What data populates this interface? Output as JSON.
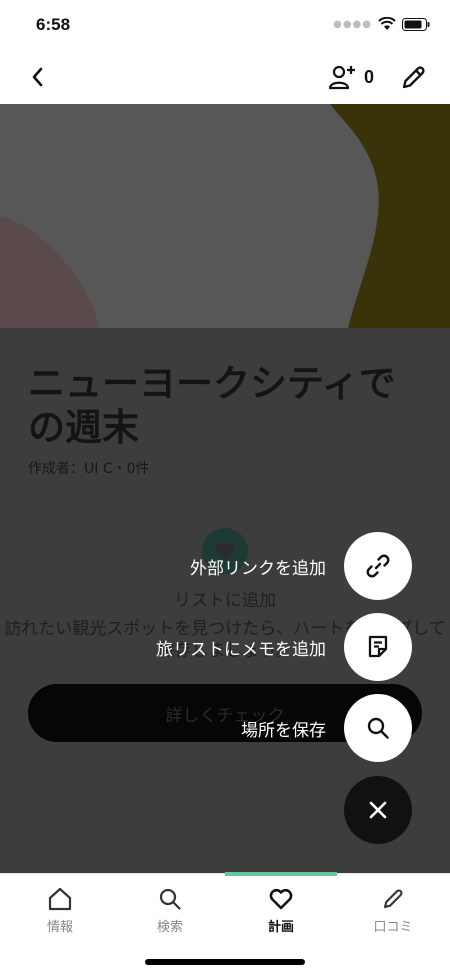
{
  "status": {
    "time": "6:58"
  },
  "nav": {
    "collaborator_count": "0"
  },
  "trip": {
    "title": "ニューヨークシティでの週末",
    "author_line": "作成者：UI C・0件"
  },
  "empty_state": {
    "title": "リストに追加",
    "description": "訪れたい観光スポットを見つけたら、ハートをタップして保存しましょう。",
    "button_label": "詳しくチェック"
  },
  "fab_menu": {
    "items": [
      {
        "label": "外部リンクを追加",
        "icon": "link-icon"
      },
      {
        "label": "旅リストにメモを追加",
        "icon": "note-icon"
      },
      {
        "label": "場所を保存",
        "icon": "search-icon"
      }
    ],
    "close_icon": "close-icon"
  },
  "tabs": [
    {
      "label": "情報",
      "icon": "home-icon",
      "active": false
    },
    {
      "label": "検索",
      "icon": "search-icon",
      "active": false
    },
    {
      "label": "計画",
      "icon": "heart-icon",
      "active": true
    },
    {
      "label": "口コミ",
      "icon": "pencil-icon",
      "active": false
    }
  ],
  "colors": {
    "overlay": "#3d3d3d",
    "accent": "#63c79a",
    "hero_olive": "#3a330a",
    "hero_rose": "#5a4a4c"
  }
}
